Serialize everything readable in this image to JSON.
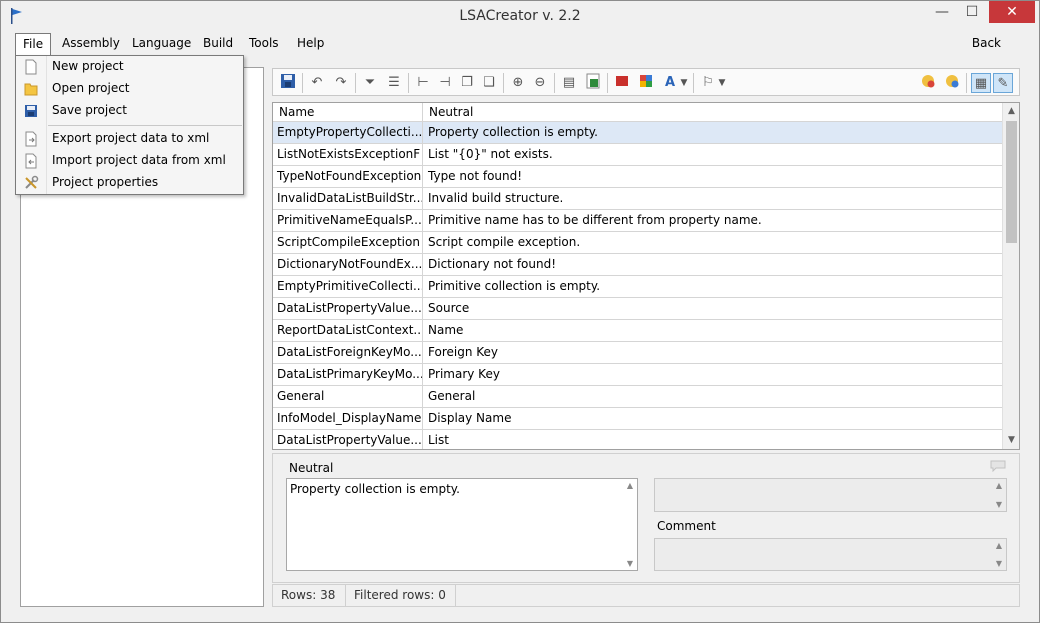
{
  "window": {
    "title": "LSACreator v. 2.2",
    "minimize": "—",
    "maximize": "☐",
    "close": "✕"
  },
  "menu": {
    "file": "File",
    "assembly": "Assembly",
    "language": "Language",
    "build": "Build",
    "tools": "Tools",
    "help": "Help",
    "back": "Back"
  },
  "file_menu": {
    "items": [
      {
        "label": "New project",
        "icon": "new-file-icon"
      },
      {
        "label": "Open project",
        "icon": "open-folder-icon"
      },
      {
        "label": "Save project",
        "icon": "save-disk-icon"
      },
      {
        "label": "Export project data to xml",
        "icon": "export-icon"
      },
      {
        "label": "Import project data from xml",
        "icon": "import-icon"
      },
      {
        "label": "Project properties",
        "icon": "properties-icon"
      }
    ]
  },
  "grid": {
    "columns": {
      "name": "Name",
      "neutral": "Neutral"
    },
    "rows": [
      {
        "name": "EmptyPropertyCollecti...",
        "neutral": "Property collection is empty."
      },
      {
        "name": "ListNotExistsExceptionF",
        "neutral": "List \"{0}\" not exists."
      },
      {
        "name": "TypeNotFoundException",
        "neutral": "Type not found!"
      },
      {
        "name": "InvalidDataListBuildStr...",
        "neutral": "Invalid build structure."
      },
      {
        "name": "PrimitiveNameEqualsP...",
        "neutral": "Primitive name has to be different from property name."
      },
      {
        "name": "ScriptCompileException",
        "neutral": "Script compile exception."
      },
      {
        "name": "DictionaryNotFoundEx...",
        "neutral": "Dictionary not found!"
      },
      {
        "name": "EmptyPrimitiveCollecti...",
        "neutral": "Primitive collection is empty."
      },
      {
        "name": "DataListPropertyValue...",
        "neutral": "Source"
      },
      {
        "name": "ReportDataListContext...",
        "neutral": "Name"
      },
      {
        "name": "DataListForeignKeyMo...",
        "neutral": "Foreign Key"
      },
      {
        "name": "DataListPrimaryKeyMo...",
        "neutral": "Primary Key"
      },
      {
        "name": "General",
        "neutral": "General"
      },
      {
        "name": "InfoModel_DisplayName",
        "neutral": "Display Name"
      },
      {
        "name": "DataListPropertyValue...",
        "neutral": "List"
      }
    ]
  },
  "detail": {
    "neutral_label": "Neutral",
    "neutral_value": "Property collection is empty.",
    "comment_label": "Comment"
  },
  "status": {
    "rows": "Rows:  38",
    "filtered": "Filtered rows:  0"
  },
  "colors": {
    "selection": "#dde8f6",
    "close": "#c7373a",
    "accent": "#6aa6d8"
  }
}
